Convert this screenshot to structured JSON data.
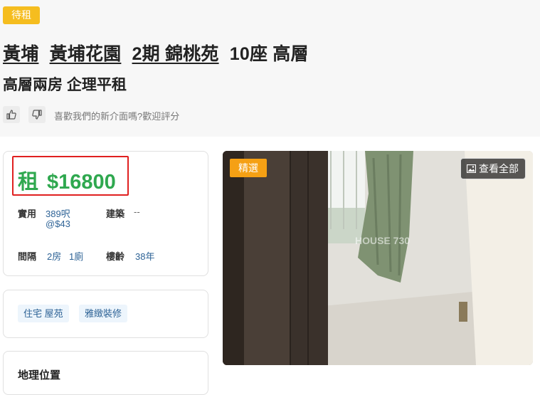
{
  "header": {
    "status_badge": "待租",
    "title_parts": [
      "黃埔",
      "黃埔花園",
      "2期 錦桃苑",
      "10座 高層"
    ],
    "subtitle": "高層兩房 企理平租",
    "feedback_text": "喜歡我們的新介面嗎?歡迎評分"
  },
  "price_card": {
    "rent_label": "租",
    "price": "$16800",
    "details": {
      "saleable_label": "實用",
      "saleable_value": "389呎",
      "saleable_unit_price": "@$43",
      "gross_label": "建築",
      "gross_value": "--",
      "layout_label": "間隔",
      "layout_rooms": "2房",
      "layout_baths": "1廁",
      "age_label": "樓齡",
      "age_value": "38年"
    }
  },
  "tags": [
    "住宅 屋苑",
    "雅緻裝修"
  ],
  "next_section": {
    "title": "地理位置"
  },
  "photo": {
    "featured_badge": "精選",
    "view_all_label": "查看全部",
    "watermark": "HOUSE 730"
  },
  "colors": {
    "status_yellow": "#f5bd1f",
    "price_green": "#2fa84f",
    "highlight_red": "#e02020",
    "link_blue": "#2e6396",
    "featured_orange": "#f5a014"
  }
}
